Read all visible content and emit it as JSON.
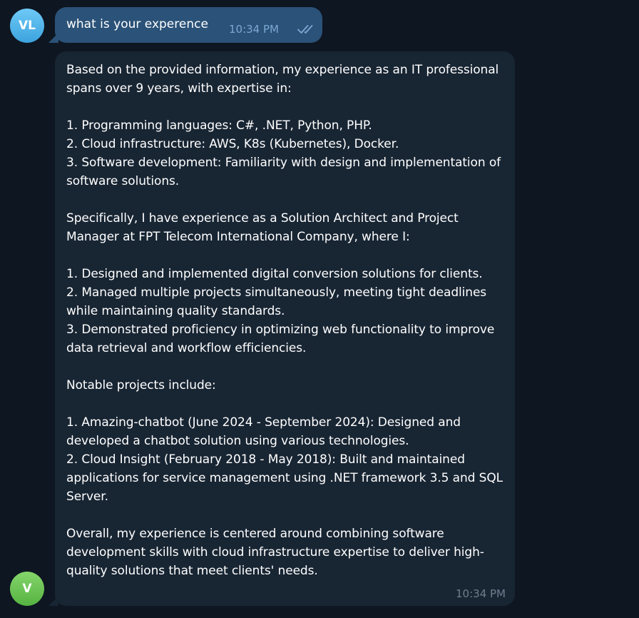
{
  "messages": [
    {
      "sender_initials": "VL",
      "avatar_color": "#4fb0e8",
      "text": "what is your experence",
      "time": "10:34 PM",
      "status_icon": "double-check-icon",
      "bubble_color": "#2b5278"
    },
    {
      "sender_initials": "V",
      "avatar_color": "#6cc552",
      "text": "Based on the provided information, my experience as an IT professional spans over 9 years, with expertise in:\n\n1. Programming languages: C#, .NET, Python, PHP.\n2. Cloud infrastructure: AWS, K8s (Kubernetes), Docker.\n3. Software development: Familiarity with design and implementation of software solutions.\n\nSpecifically, I have experience as a Solution Architect and Project Manager at FPT Telecom International Company, where I:\n\n1. Designed and implemented digital conversion solutions for clients.\n2. Managed multiple projects simultaneously, meeting tight deadlines while maintaining quality standards.\n3. Demonstrated proficiency in optimizing web functionality to improve data retrieval and workflow efficiencies.\n\nNotable projects include:\n\n1. Amazing-chatbot (June 2024 - September 2024): Designed and developed a chatbot solution using various technologies.\n2. Cloud Insight (February 2018 - May 2018): Built and maintained applications for service management using .NET framework 3.5 and SQL Server.\n\nOverall, my experience is centered around combining software development skills with cloud infrastructure expertise to deliver high-quality solutions that meet clients' needs.",
      "time": "10:34 PM",
      "bubble_color": "#182533"
    }
  ],
  "theme": {
    "background": "#0e1621",
    "accent": "#7da8d3"
  }
}
